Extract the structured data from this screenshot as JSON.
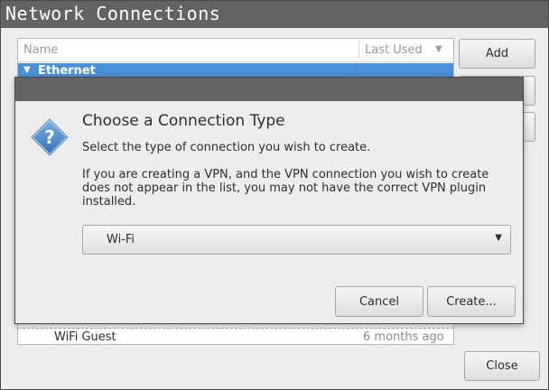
{
  "window": {
    "title": "Network Connections"
  },
  "list": {
    "columns": {
      "name": "Name",
      "last_used": "Last Used"
    },
    "group": {
      "label": "Ethernet"
    },
    "rows": [
      {
        "name": "WiFi Guest",
        "last_used": "6 months ago"
      }
    ]
  },
  "buttons": {
    "add": "Add",
    "close": "Close"
  },
  "dialog": {
    "heading": "Choose a Connection Type",
    "subtitle": "Select the type of connection you wish to create.",
    "info": "If you are creating a VPN, and the VPN connection you wish to create does not appear in the list, you may not have the correct VPN plugin installed.",
    "selected_type": "Wi-Fi",
    "cancel": "Cancel",
    "create": "Create..."
  },
  "icons": {
    "dialog_icon": "question-icon",
    "sort": "sort-down-icon",
    "expand": "expand-triangle-icon",
    "dropdown": "chevron-down-icon"
  },
  "colors": {
    "titlebar": "#636363",
    "selection": "#4a90d9",
    "window_bg": "#ededed"
  }
}
